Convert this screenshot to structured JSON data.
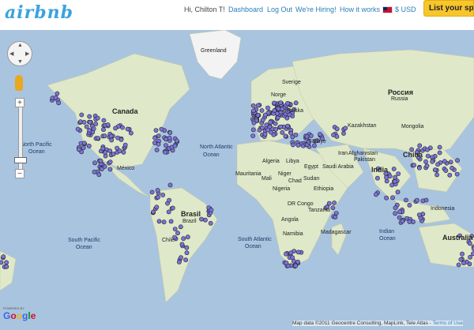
{
  "header": {
    "logo": "airbnb",
    "greeting": "Hi, Chilton T!",
    "nav": [
      "Dashboard",
      "Log Out",
      "We're Hiring!",
      "How it works"
    ],
    "currency": "$ USD",
    "list_button": "List your spac"
  },
  "map": {
    "labels": {
      "greenland": "Greenland",
      "canada": "Canada",
      "north_pacific": "North Pacific",
      "ocean1": "Ocean",
      "north_atlantic": "North Atlantic",
      "ocean2": "Ocean",
      "mexico": "México",
      "brasil": "Brasil",
      "brazil": "Brazil",
      "south_pacific": "South Pacific",
      "ocean3": "Ocean",
      "south_atlantic": "South Atlantic",
      "ocean4": "Ocean",
      "chile": "Chile",
      "mauritania": "Mauritania",
      "mali": "Mali",
      "niger": "Niger",
      "chad": "Chad",
      "nigeria": "Nigeria",
      "algeria": "Algeria",
      "libya": "Libya",
      "egypt": "Egypt",
      "sudan": "Sudan",
      "ethiopia": "Ethiopia",
      "drc": "DR Congo",
      "tanzania": "Tanzania",
      "angola": "Angola",
      "namibia": "Namibia",
      "madagascar": "Madagascar",
      "saudi": "Saudi Arabia",
      "iran": "Iran",
      "afghanistan": "Afghanistan",
      "pakistan": "Pakistan",
      "india": "India",
      "kazakhstan": "Kazakhstan",
      "mongolia": "Mongolia",
      "china": "China",
      "rossiya": "Россия",
      "russia": "Russia",
      "sverige": "Sverige",
      "norge": "Norge",
      "polska": "Polska",
      "turkiye": "Türkiye",
      "indonesia": "Indonesia",
      "australia": "Australia",
      "indian_ocean": "Indian",
      "ocean5": "Ocean"
    }
  },
  "controls": {
    "zoom_in": "+",
    "zoom_out": "−"
  },
  "footer": {
    "powered_by": "POWERED BY",
    "google": "Google",
    "attribution": "Map data ©2011 Geocentre Consulting, MapLink, Tele Atlas -",
    "terms": "Terms of Use"
  },
  "colors": {
    "ocean": "#a9c4df",
    "land": "#dfe8c8",
    "marker": "#7b74d9",
    "brand": "#3ba3dc",
    "list_button": "#f7c52c"
  }
}
